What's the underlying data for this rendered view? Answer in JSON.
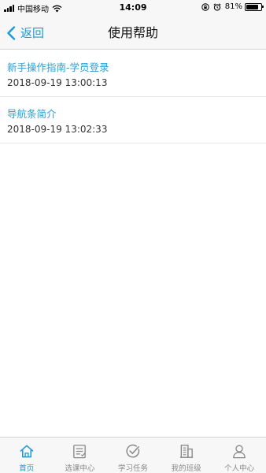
{
  "status_bar": {
    "carrier": "中国移动",
    "time": "14:09",
    "battery": "81%",
    "battery_level": 0.81,
    "icons": [
      "signal-icon",
      "wifi-icon",
      "orientation-lock-icon",
      "alarm-icon",
      "battery-icon"
    ]
  },
  "nav": {
    "back_label": "返回",
    "title": "使用帮助"
  },
  "help_items": [
    {
      "title": "新手操作指南-学员登录",
      "time": "2018-09-19 13:00:13"
    },
    {
      "title": "导航条简介",
      "time": "2018-09-19 13:02:33"
    }
  ],
  "tab_bar": {
    "items": [
      {
        "label": "首页",
        "icon": "home-icon",
        "active": true
      },
      {
        "label": "选课中心",
        "icon": "course-list-icon",
        "active": false
      },
      {
        "label": "学习任务",
        "icon": "check-circle-icon",
        "active": false
      },
      {
        "label": "我的班级",
        "icon": "class-building-icon",
        "active": false
      },
      {
        "label": "个人中心",
        "icon": "person-icon",
        "active": false
      }
    ]
  },
  "colors": {
    "accent": "#1a9bd8",
    "item_title": "#2a9fd6",
    "bar_background": "#f7f7f7",
    "inactive_tab": "#8a8a8a"
  }
}
